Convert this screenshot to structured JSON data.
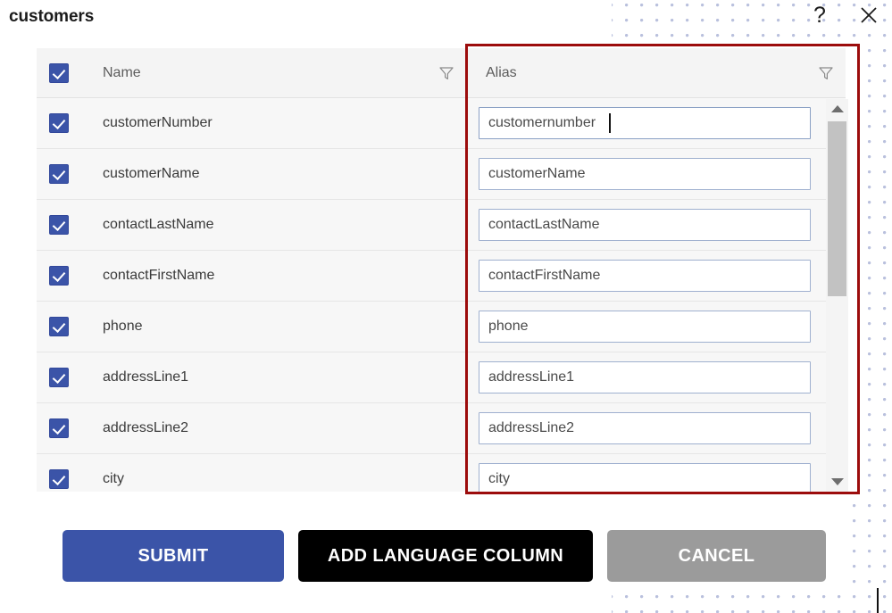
{
  "window": {
    "title": "customers",
    "help_icon": "question-mark-icon",
    "close_icon": "close-icon"
  },
  "table": {
    "columns": [
      {
        "key": "name",
        "header": "Name",
        "filter_icon": "filter-icon"
      },
      {
        "key": "alias",
        "header": "Alias",
        "filter_icon": "filter-icon"
      }
    ],
    "header_checkbox_checked": true,
    "rows": [
      {
        "checked": true,
        "name": "customerNumber",
        "alias": "customernumber",
        "focused": true
      },
      {
        "checked": true,
        "name": "customerName",
        "alias": "customerName",
        "focused": false
      },
      {
        "checked": true,
        "name": "contactLastName",
        "alias": "contactLastName",
        "focused": false
      },
      {
        "checked": true,
        "name": "contactFirstName",
        "alias": "contactFirstName",
        "focused": false
      },
      {
        "checked": true,
        "name": "phone",
        "alias": "phone",
        "focused": false
      },
      {
        "checked": true,
        "name": "addressLine1",
        "alias": "addressLine1",
        "focused": false
      },
      {
        "checked": true,
        "name": "addressLine2",
        "alias": "addressLine2",
        "focused": false
      },
      {
        "checked": true,
        "name": "city",
        "alias": "city",
        "focused": false
      }
    ]
  },
  "scrollbar": {
    "up_icon": "chevron-up-icon",
    "down_icon": "chevron-down-icon",
    "orientation": "vertical"
  },
  "highlight": {
    "color": "#9c0c0c",
    "target": "alias-column"
  },
  "buttons": {
    "submit": "SUBMIT",
    "add_language_column": "ADD LANGUAGE COLUMN",
    "cancel": "CANCEL"
  },
  "colors": {
    "accent_blue": "#3b54a8",
    "black_button": "#000000",
    "cancel_gray": "#9b9b9b",
    "highlight_red": "#9c0c0c",
    "row_bg": "#f7f7f7",
    "dot_pattern": "#b9c0dd"
  }
}
